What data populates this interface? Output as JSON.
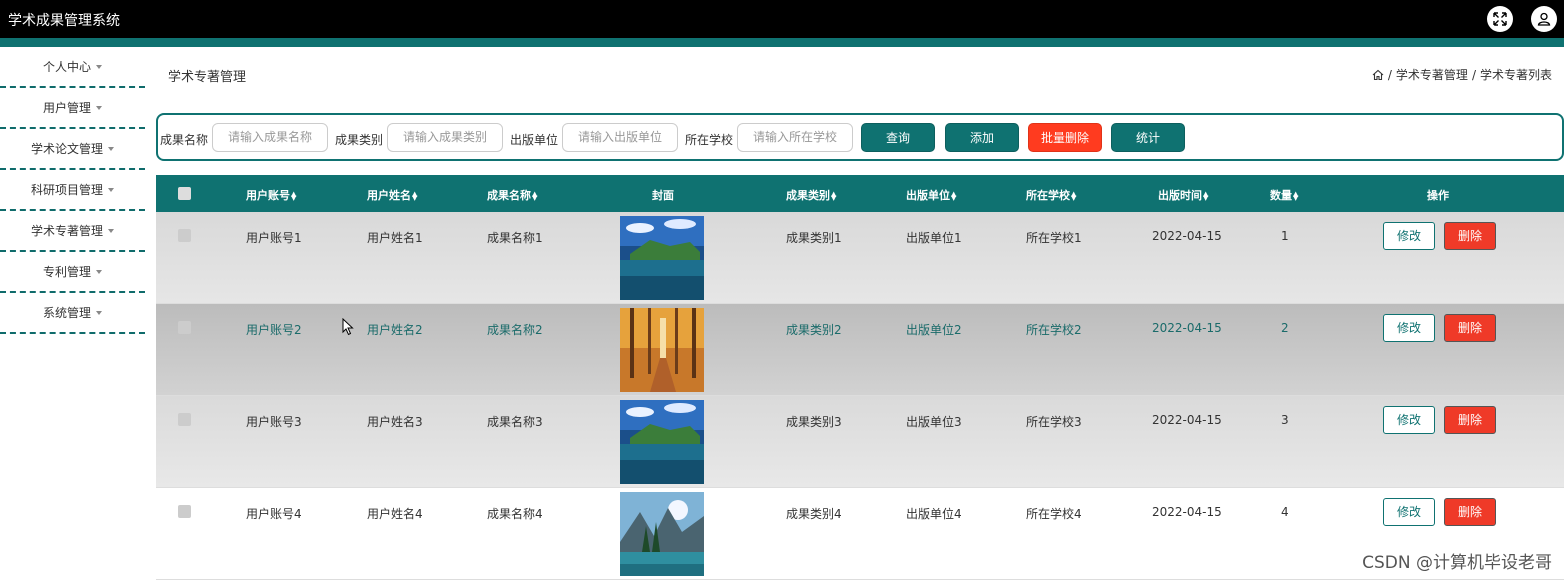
{
  "app": {
    "title": "学术成果管理系统"
  },
  "header_icons": [
    "fullscreen-icon",
    "user-icon"
  ],
  "sidebar": {
    "items": [
      {
        "label": "个人中心"
      },
      {
        "label": "用户管理"
      },
      {
        "label": "学术论文管理"
      },
      {
        "label": "科研项目管理"
      },
      {
        "label": "学术专著管理"
      },
      {
        "label": "专利管理"
      },
      {
        "label": "系统管理"
      }
    ]
  },
  "page": {
    "title": "学术专著管理"
  },
  "breadcrumb": {
    "items": [
      "学术专著管理",
      "学术专著列表"
    ],
    "separator": "/"
  },
  "search": {
    "fields": [
      {
        "label": "成果名称",
        "placeholder": "请输入成果名称"
      },
      {
        "label": "成果类别",
        "placeholder": "请输入成果类别"
      },
      {
        "label": "出版单位",
        "placeholder": "请输入出版单位"
      },
      {
        "label": "所在学校",
        "placeholder": "请输入所在学校"
      }
    ],
    "buttons": {
      "query": "查询",
      "add": "添加",
      "batch_delete": "批量删除",
      "stats": "统计"
    }
  },
  "table": {
    "headers": {
      "account": "用户账号",
      "name": "用户姓名",
      "title": "成果名称",
      "cover": "封面",
      "category": "成果类别",
      "publisher": "出版单位",
      "school": "所在学校",
      "date": "出版时间",
      "count": "数量",
      "actions": "操作"
    },
    "edit_label": "修改",
    "delete_label": "删除",
    "rows": [
      {
        "account": "用户账号1",
        "name": "用户姓名1",
        "title": "成果名称1",
        "category": "成果类别1",
        "publisher": "出版单位1",
        "school": "所在学校1",
        "date": "2022-04-15",
        "count": "1"
      },
      {
        "account": "用户账号2",
        "name": "用户姓名2",
        "title": "成果名称2",
        "category": "成果类别2",
        "publisher": "出版单位2",
        "school": "所在学校2",
        "date": "2022-04-15",
        "count": "2"
      },
      {
        "account": "用户账号3",
        "name": "用户姓名3",
        "title": "成果名称3",
        "category": "成果类别3",
        "publisher": "出版单位3",
        "school": "所在学校3",
        "date": "2022-04-15",
        "count": "3"
      },
      {
        "account": "用户账号4",
        "name": "用户姓名4",
        "title": "成果名称4",
        "category": "成果类别4",
        "publisher": "出版单位4",
        "school": "所在学校4",
        "date": "2022-04-15",
        "count": "4"
      }
    ]
  },
  "watermark": "CSDN @计算机毕设老哥",
  "colors": {
    "teal": "#0f7271",
    "danger": "#ef3a28",
    "topbar": "#000000"
  }
}
